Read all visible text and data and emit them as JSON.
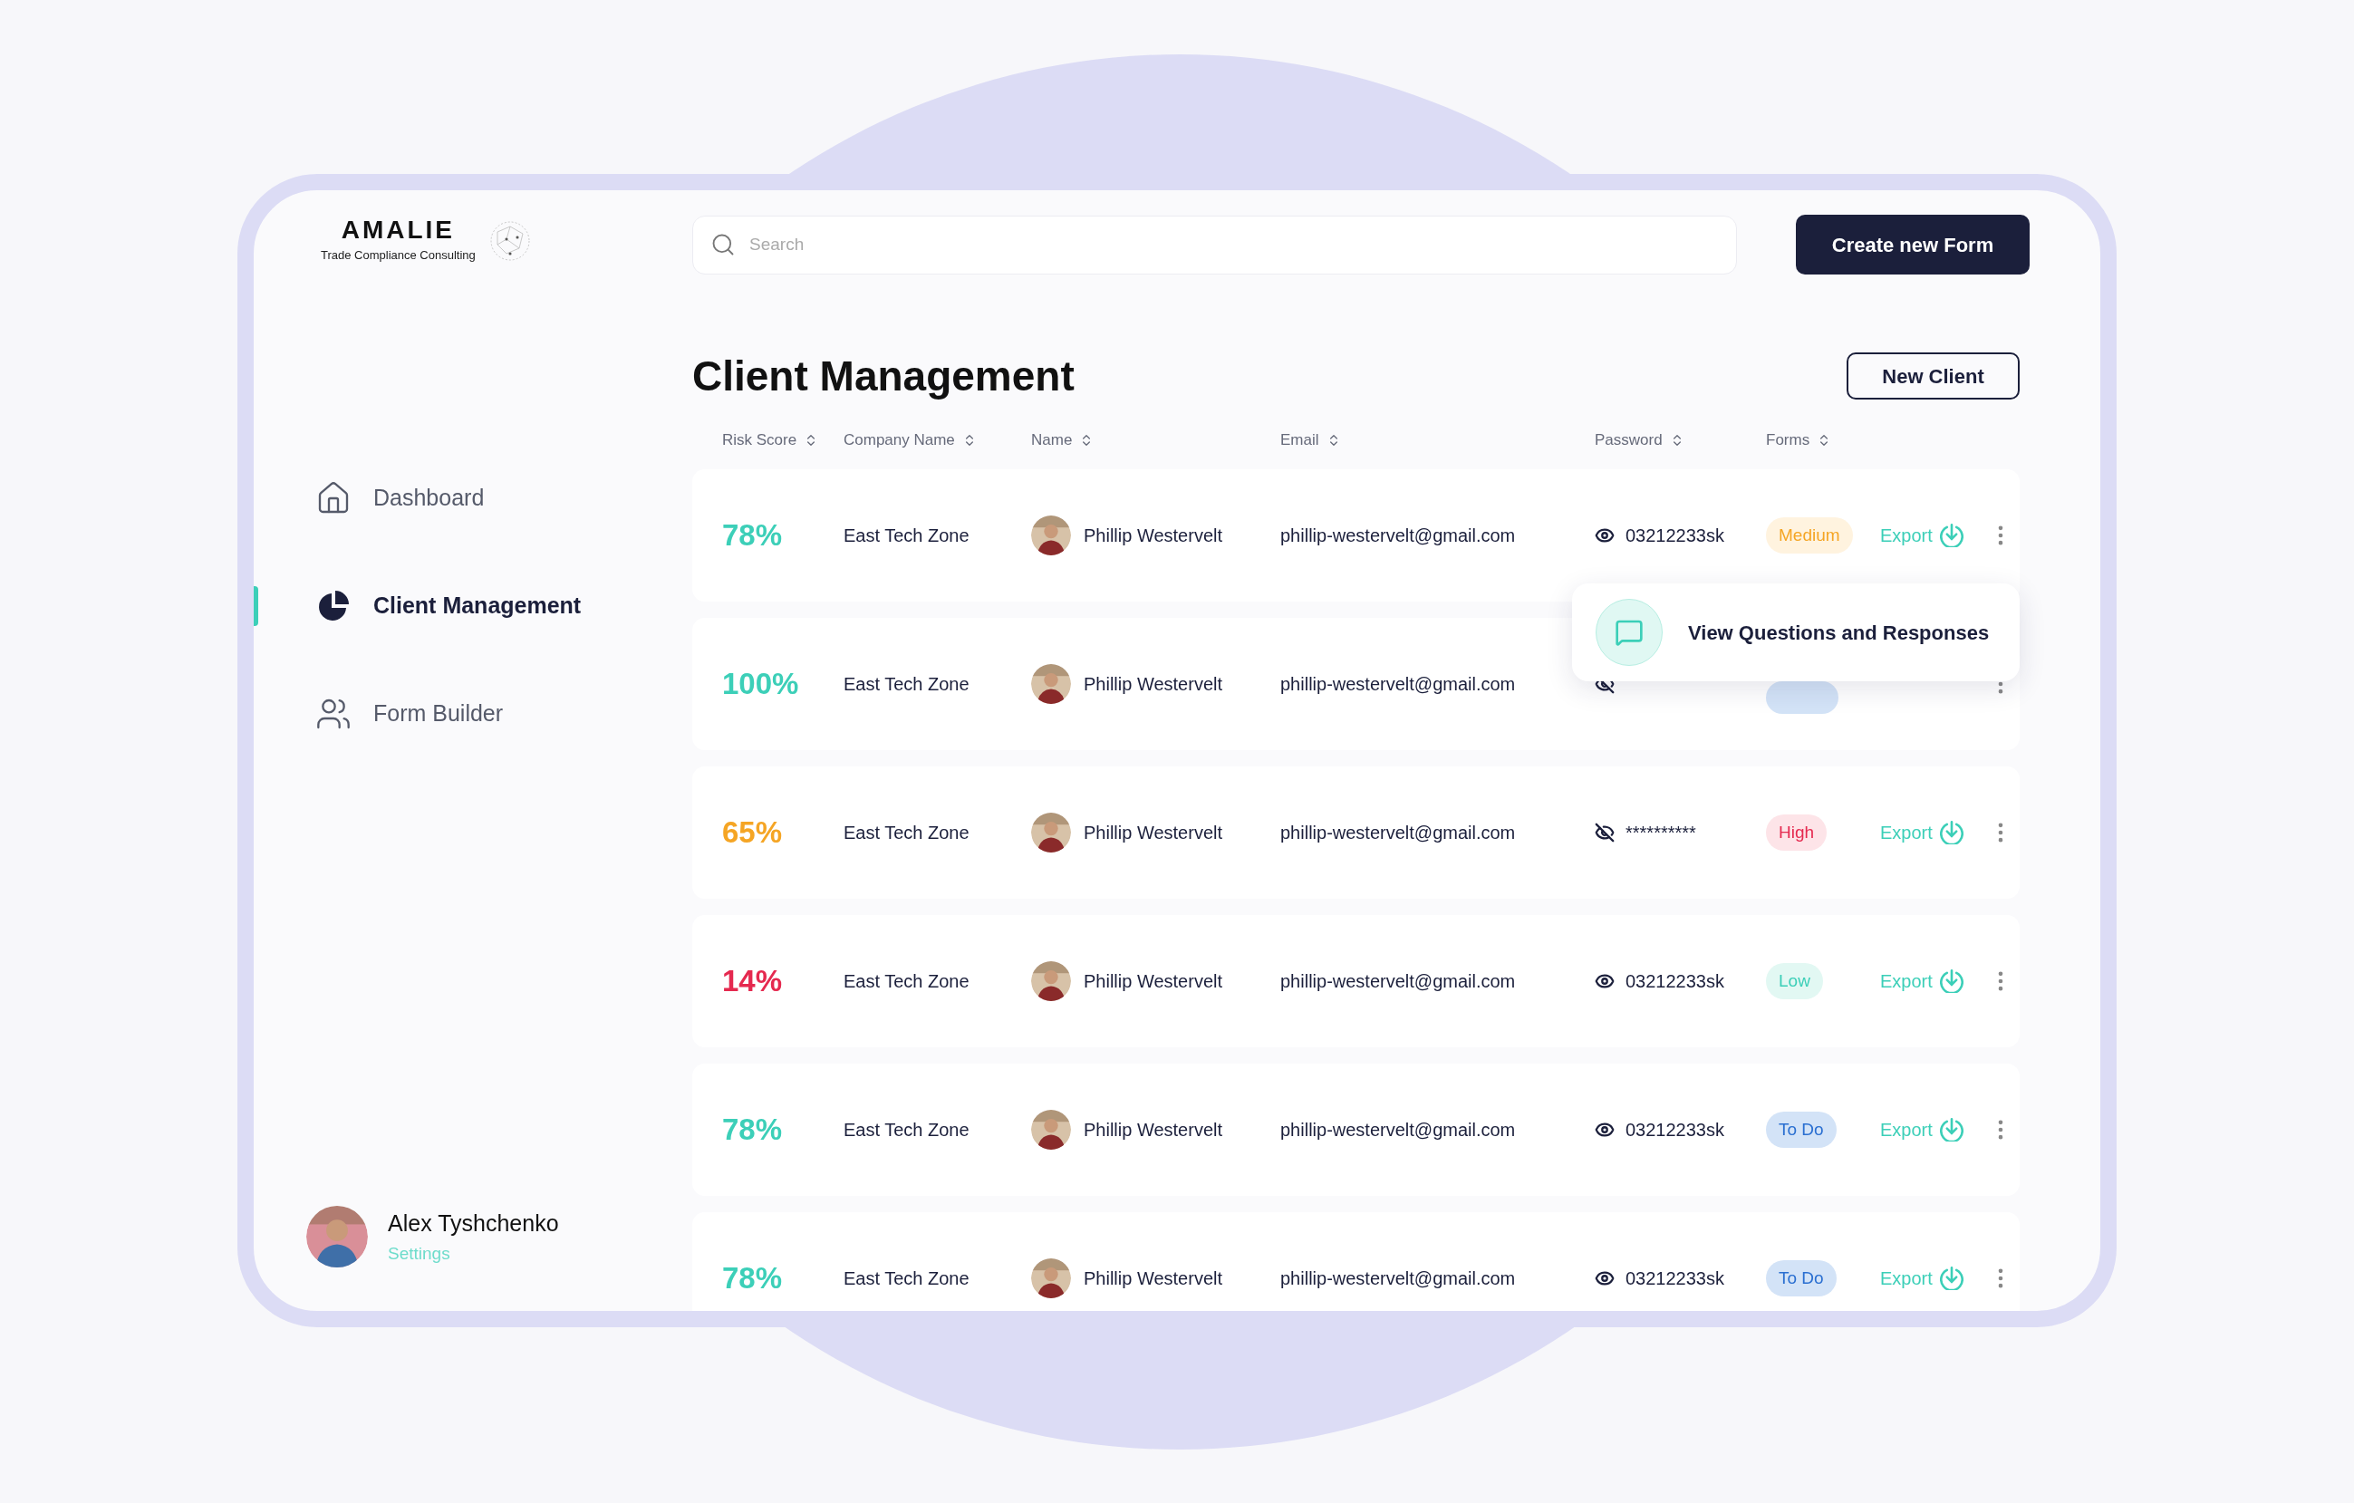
{
  "brand": {
    "name": "AMALIE",
    "tagline": "Trade Compliance Consulting"
  },
  "search": {
    "placeholder": "Search"
  },
  "create_button": "Create new Form",
  "nav": [
    {
      "label": "Dashboard",
      "kind": "home",
      "selected": false
    },
    {
      "label": "Client Management",
      "kind": "pie",
      "selected": true
    },
    {
      "label": "Form Builder",
      "kind": "users",
      "selected": false
    }
  ],
  "user": {
    "name": "Alex Tyshchenko",
    "link": "Settings"
  },
  "page_title": "Client Management",
  "new_client_button": "New Client",
  "columns": [
    "Risk Score",
    "Company Name",
    "Name",
    "Email",
    "Password",
    "Forms"
  ],
  "rows": [
    {
      "risk": "78%",
      "color": "#3ccfb8",
      "company": "East Tech Zone",
      "name": "Phillip Westervelt",
      "email": "phillip-westervelt@gmail.com",
      "password": {
        "visible": true,
        "value": "03212233sk"
      },
      "badge": {
        "label": "Medium",
        "kind": "medium"
      },
      "export": "Export"
    },
    {
      "risk": "100%",
      "color": "#3ccfb8",
      "company": "East Tech Zone",
      "name": "Phillip Westervelt",
      "email": "phillip-westervelt@gmail.com",
      "password": {
        "visible": false
      },
      "badge": {
        "kind": "todo"
      },
      "popover": "View Questions and Responses"
    },
    {
      "risk": "65%",
      "color": "#f5a524",
      "company": "East Tech Zone",
      "name": "Phillip Westervelt",
      "email": "phillip-westervelt@gmail.com",
      "password": {
        "visible": false,
        "value": "**********"
      },
      "badge": {
        "label": "High",
        "kind": "high"
      },
      "export": "Export"
    },
    {
      "risk": "14%",
      "color": "#e5294f",
      "company": "East Tech Zone",
      "name": "Phillip Westervelt",
      "email": "phillip-westervelt@gmail.com",
      "password": {
        "visible": true,
        "value": "03212233sk"
      },
      "badge": {
        "label": "Low",
        "kind": "low"
      },
      "export": "Export"
    },
    {
      "risk": "78%",
      "color": "#3ccfb8",
      "company": "East Tech Zone",
      "name": "Phillip Westervelt",
      "email": "phillip-westervelt@gmail.com",
      "password": {
        "visible": true,
        "value": "03212233sk"
      },
      "badge": {
        "label": "To Do",
        "kind": "todo"
      },
      "export": "Export"
    },
    {
      "risk": "78%",
      "color": "#3ccfb8",
      "company": "East Tech Zone",
      "name": "Phillip Westervelt",
      "email": "phillip-westervelt@gmail.com",
      "password": {
        "visible": true,
        "value": "03212233sk"
      },
      "badge": {
        "label": "To Do",
        "kind": "todo"
      },
      "export": "Export"
    }
  ]
}
